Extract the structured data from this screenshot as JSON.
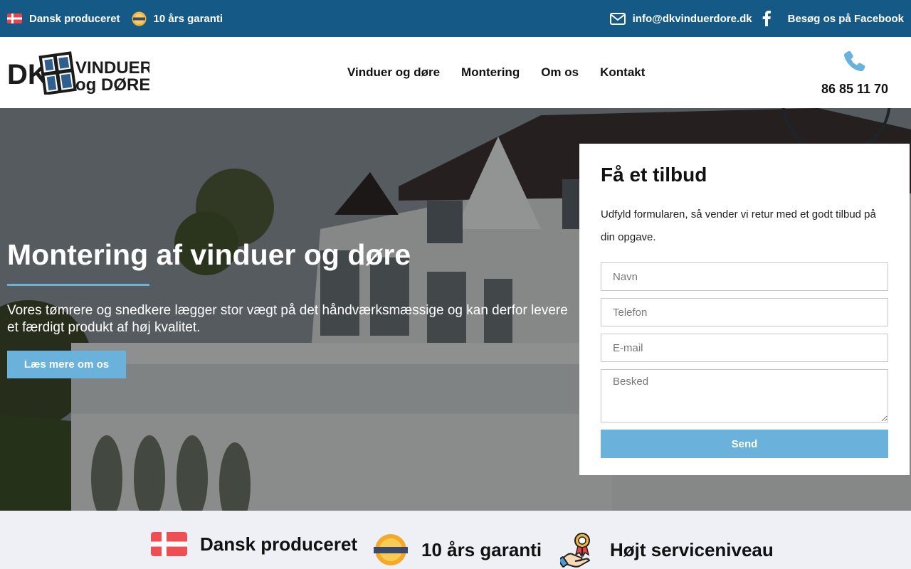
{
  "topbar": {
    "danish_label": "Dansk produceret",
    "warranty_label": "10 års garanti",
    "email": "info@dkvinduerdore.dk",
    "facebook_label": "Besøg os på Facebook",
    "background": "#155a86"
  },
  "header": {
    "logo": {
      "part1": "DK",
      "part2": "VINDUER",
      "part3": "og DØRE"
    },
    "nav": [
      {
        "label": "Vinduer og døre"
      },
      {
        "label": "Montering"
      },
      {
        "label": "Om os"
      },
      {
        "label": "Kontakt"
      }
    ],
    "phone": "86 85 11 70"
  },
  "hero": {
    "title": "Montering af vinduer og døre",
    "text": "Vores tømrere og snedkere lægger stor vægt på det håndværksmæssige og kan derfor levere et færdigt produkt af høj kvalitet.",
    "button_label": "Læs mere om os"
  },
  "form": {
    "title": "Få et tilbud",
    "description": "Udfyld formularen, så vender vi retur med et godt tilbud på din opgave.",
    "name_placeholder": "Navn",
    "phone_placeholder": "Telefon",
    "email_placeholder": "E-mail",
    "message_placeholder": "Besked",
    "send_label": "Send"
  },
  "features": [
    {
      "label": "Dansk produceret",
      "icon": "danish-flag-icon"
    },
    {
      "label": "10 års garanti",
      "icon": "guarantee-badge-icon"
    },
    {
      "label": "Højt serviceniveau",
      "icon": "award-hand-icon"
    }
  ],
  "colors": {
    "accent": "#6ab2dc",
    "topbar": "#155a86",
    "strip": "#eef0f5"
  }
}
